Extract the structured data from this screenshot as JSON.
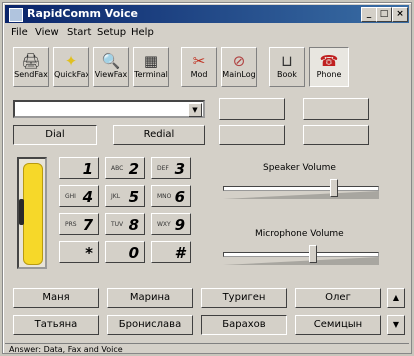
{
  "window": {
    "title": "RapidComm Voice"
  },
  "menu": [
    "File",
    "View",
    "Start",
    "Setup",
    "Help"
  ],
  "toolbar": [
    {
      "label": "SendFax",
      "icon": "send-fax-icon"
    },
    {
      "label": "QuickFax",
      "icon": "quick-fax-icon"
    },
    {
      "label": "ViewFax",
      "icon": "view-fax-icon"
    },
    {
      "label": "Terminal",
      "icon": "terminal-icon"
    },
    {
      "label": "Mod",
      "icon": "mod-icon"
    },
    {
      "label": "MainLog",
      "icon": "main-log-icon"
    },
    {
      "label": "Book",
      "icon": "book-icon"
    },
    {
      "label": "Phone",
      "icon": "phone-icon"
    }
  ],
  "dialer": {
    "number_value": "",
    "dial_label": "Dial",
    "redial_label": "Redial"
  },
  "keypad": [
    {
      "digit": "1",
      "sub": ""
    },
    {
      "digit": "2",
      "sub": "ABC"
    },
    {
      "digit": "3",
      "sub": "DEF"
    },
    {
      "digit": "4",
      "sub": "GHI"
    },
    {
      "digit": "5",
      "sub": "JKL"
    },
    {
      "digit": "6",
      "sub": "MNO"
    },
    {
      "digit": "7",
      "sub": "PRS"
    },
    {
      "digit": "8",
      "sub": "TUV"
    },
    {
      "digit": "9",
      "sub": "WXY"
    },
    {
      "digit": "*",
      "sub": ""
    },
    {
      "digit": "0",
      "sub": ""
    },
    {
      "digit": "#",
      "sub": ""
    }
  ],
  "speaker": {
    "label": "Speaker Volume",
    "level": 0.72
  },
  "microphone": {
    "label": "Microphone Volume",
    "level": 0.58
  },
  "speed_dial": [
    [
      "Маня",
      "Марина",
      "Туриген",
      "Олег"
    ],
    [
      "Татьяна",
      "Бронислава",
      "Барахов",
      "Семицын"
    ]
  ],
  "status": {
    "text": "Answer: Data, Fax and Voice"
  }
}
